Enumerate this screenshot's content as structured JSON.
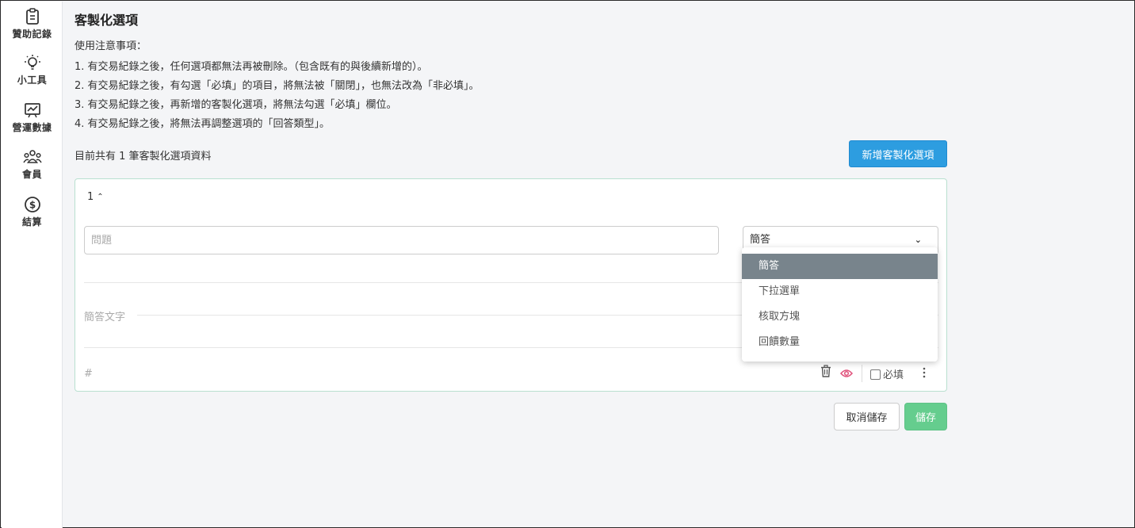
{
  "sidebar": {
    "items": [
      {
        "label": "贊助記錄",
        "icon": "clipboard-icon"
      },
      {
        "label": "小工具",
        "icon": "lightbulb-icon"
      },
      {
        "label": "營運數據",
        "icon": "chart-board-icon"
      },
      {
        "label": "會員",
        "icon": "members-icon"
      },
      {
        "label": "結算",
        "icon": "dollar-circle-icon"
      }
    ]
  },
  "page": {
    "title": "客製化選項",
    "notes_heading": "使用注意事項：",
    "notes": [
      "1. 有交易紀錄之後，任何選項都無法再被刪除。（包含既有的與後續新增的）。",
      "2. 有交易紀錄之後，有勾選「必填」的項目，將無法被「關閉」，也無法改為「非必填」。",
      "3. 有交易紀錄之後，再新增的客製化選項，將無法勾選「必填」欄位。",
      "4. 有交易紀錄之後，將無法再調整選項的「回答類型」。"
    ],
    "count_text": "目前共有 1 筆客製化選項資料",
    "add_button": "新增客製化選項"
  },
  "card": {
    "order_value": "1",
    "question_placeholder": "問題",
    "type_selected": "簡答",
    "type_options": [
      "簡答",
      "下拉選單",
      "核取方塊",
      "回饋數量"
    ],
    "answer_placeholder": "簡答文字",
    "hash": "#",
    "required_label": "必填",
    "required_checked": false
  },
  "actions": {
    "cancel": "取消儲存",
    "save": "儲存"
  },
  "colors": {
    "primary": "#2d9de0",
    "save": "#65cd8e",
    "selected_option": "#78848c",
    "eye_icon": "#e0507a",
    "card_border": "#b9e0d0"
  }
}
